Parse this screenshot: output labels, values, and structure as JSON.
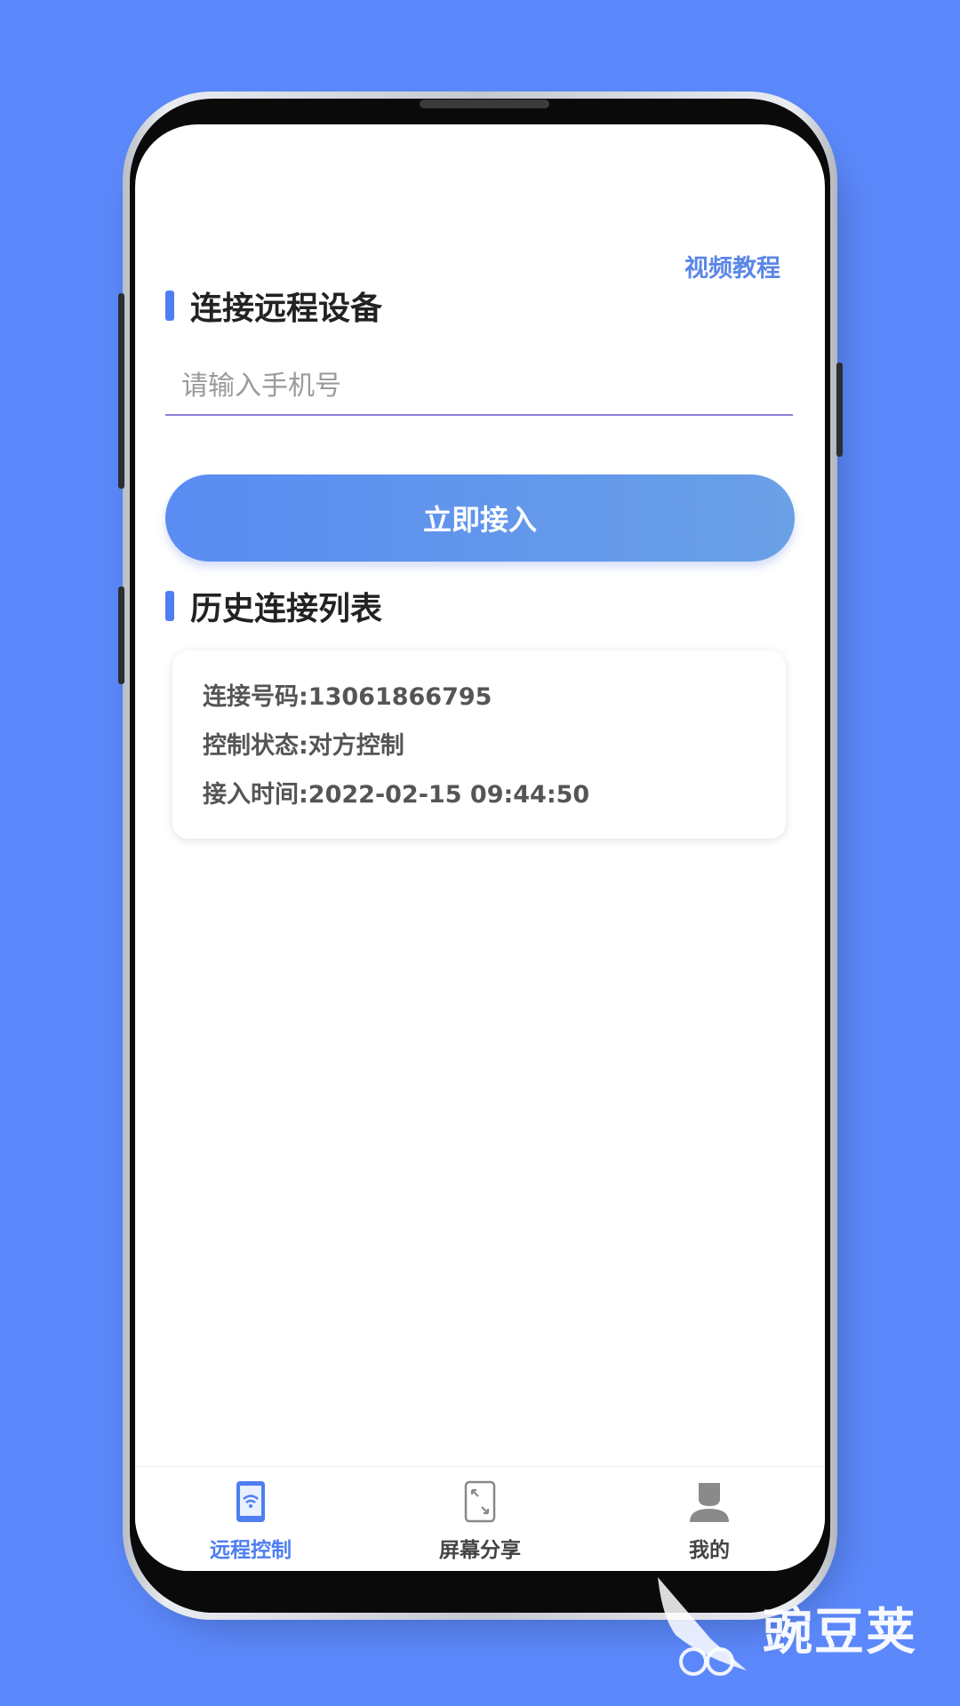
{
  "header": {
    "video_tutorial_label": "视频教程"
  },
  "connect_section": {
    "title": "连接远程设备",
    "input_placeholder": "请输入手机号",
    "input_value": "",
    "connect_button_label": "立即接入"
  },
  "history_section": {
    "title": "历史连接列表",
    "records": [
      {
        "number_line": "连接号码:13061866795",
        "status_line": "控制状态:对方控制",
        "time_line": "接入时间:2022-02-15 09:44:50"
      }
    ]
  },
  "bottom_nav": {
    "items": [
      {
        "label": "远程控制",
        "icon": "phone-wifi-icon",
        "active": true
      },
      {
        "label": "屏幕分享",
        "icon": "screen-share-icon",
        "active": false
      },
      {
        "label": "我的",
        "icon": "user-icon",
        "active": false
      }
    ]
  },
  "watermark": {
    "text": "豌豆荚"
  },
  "colors": {
    "background": "#5b88fb",
    "accent": "#4e7ef0",
    "button_gradient_start": "#5a8cf2",
    "button_gradient_end": "#6aa0e6"
  }
}
